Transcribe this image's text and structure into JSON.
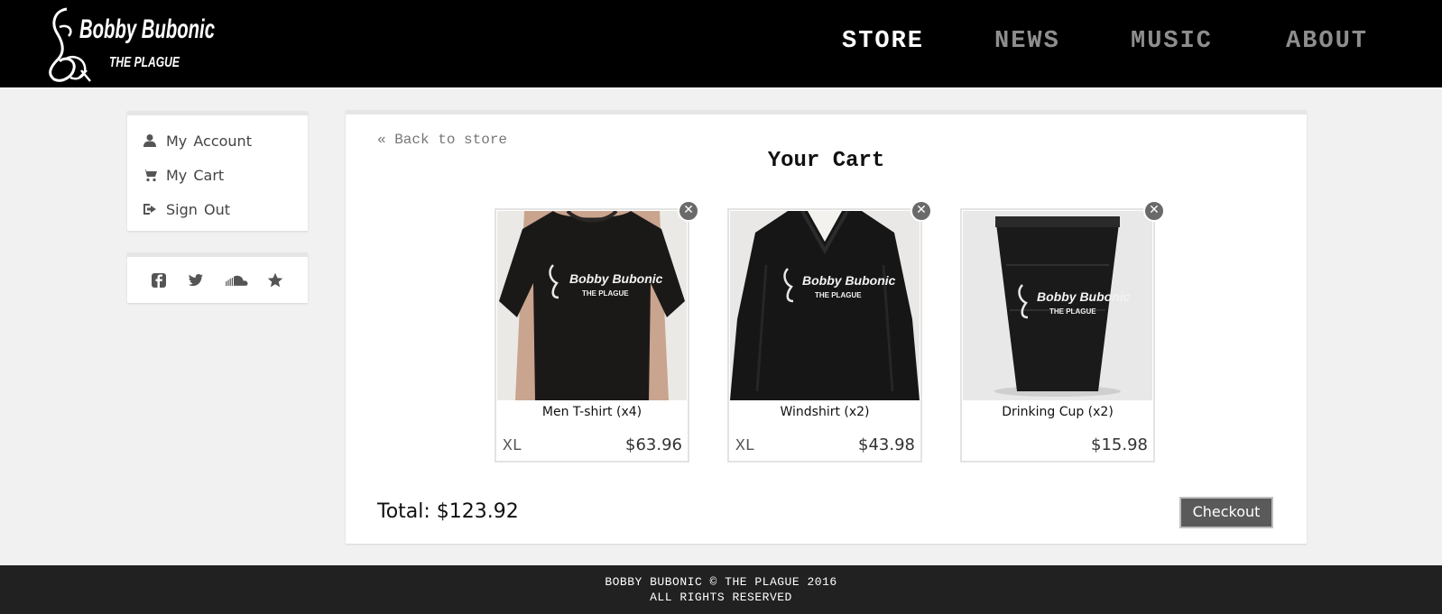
{
  "header": {
    "logo": {
      "line1": "Bobby Bubonic",
      "line2": "THE PLAGUE"
    },
    "nav": [
      {
        "label": "STORE",
        "active": true
      },
      {
        "label": "NEWS",
        "active": false
      },
      {
        "label": "MUSIC",
        "active": false
      },
      {
        "label": "ABOUT",
        "active": false
      }
    ]
  },
  "sidebar": {
    "menu": [
      {
        "label": "My Account",
        "icon": "user-icon"
      },
      {
        "label": "My Cart",
        "icon": "cart-icon"
      },
      {
        "label": "Sign Out",
        "icon": "sign-out-icon"
      }
    ],
    "social": [
      "facebook-icon",
      "twitter-icon",
      "soundcloud-icon",
      "star-icon"
    ]
  },
  "cart": {
    "back_link": "« Back to store",
    "title": "Your Cart",
    "items": [
      {
        "name": "Men T-shirt (x4)",
        "size": "XL",
        "price": "$63.96",
        "image": "tshirt"
      },
      {
        "name": "Windshirt (x2)",
        "size": "XL",
        "price": "$43.98",
        "image": "windshirt"
      },
      {
        "name": "Drinking Cup (x2)",
        "size": "",
        "price": "$15.98",
        "image": "cup"
      }
    ],
    "total_label": "Total:",
    "total_value": "$123.92",
    "checkout_label": "Checkout"
  },
  "footer": {
    "line1": "BOBBY BUBONIC © THE PLAGUE 2016",
    "line2": "ALL RIGHTS RESERVED"
  },
  "colors": {
    "header_bg": "#000000",
    "page_bg": "#f1f1f1",
    "footer_bg": "#212121",
    "checkout_bg": "#5a5a5a"
  }
}
